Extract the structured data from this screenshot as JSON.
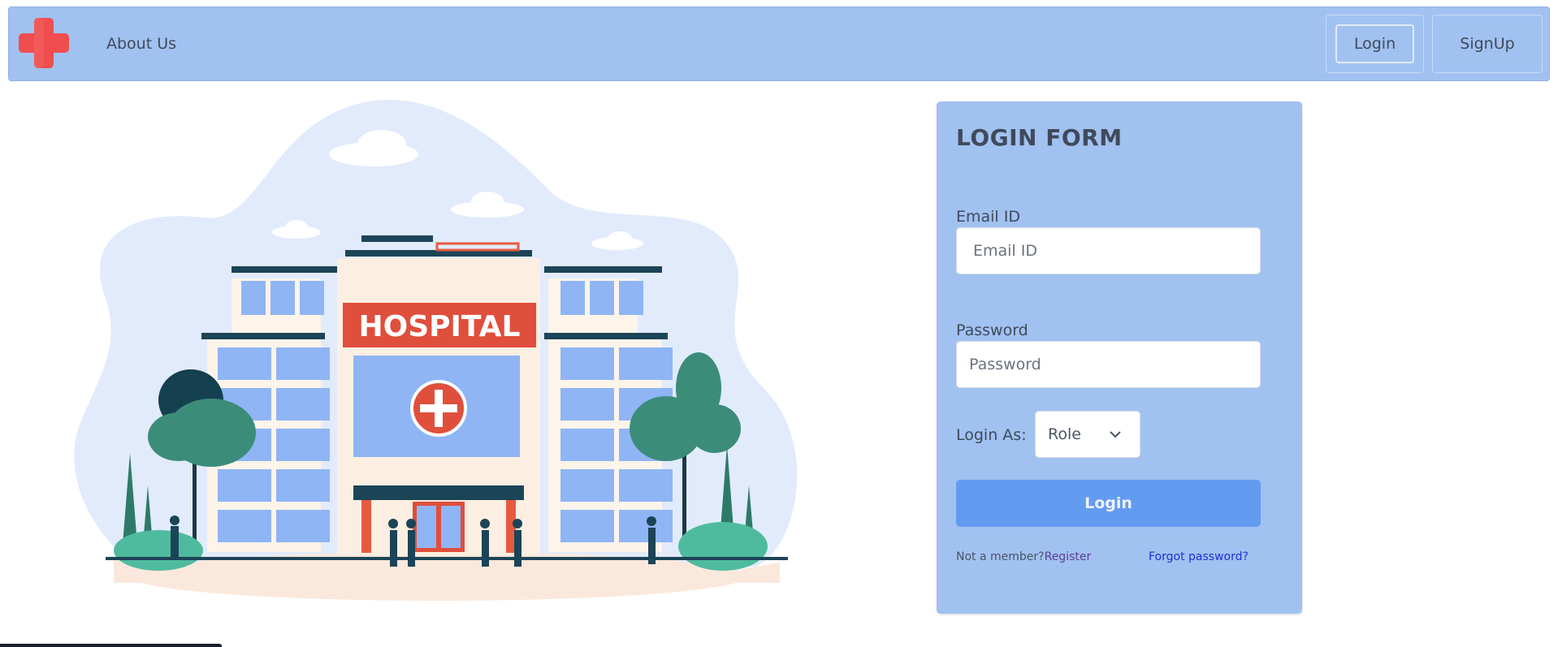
{
  "navbar": {
    "logo_icon": "red-cross-icon",
    "about_label": "About Us",
    "login_label": "Login",
    "signup_label": "SignUp"
  },
  "illustration": {
    "sign_text": "HOSPITAL"
  },
  "form": {
    "title": "LOGIN FORM",
    "email_label": "Email ID",
    "email_placeholder": "Email ID",
    "password_label": "Password",
    "password_placeholder": "Password",
    "role_label": "Login As:",
    "role_value": "Role",
    "submit_label": "Login",
    "not_member_text": "Not a member?",
    "register_label": "Register",
    "forgot_label": "Forgot password?"
  },
  "colors": {
    "navbar_bg": "#a1c1f1",
    "accent_button": "#639bf0",
    "logo_red": "#f04e4e"
  }
}
